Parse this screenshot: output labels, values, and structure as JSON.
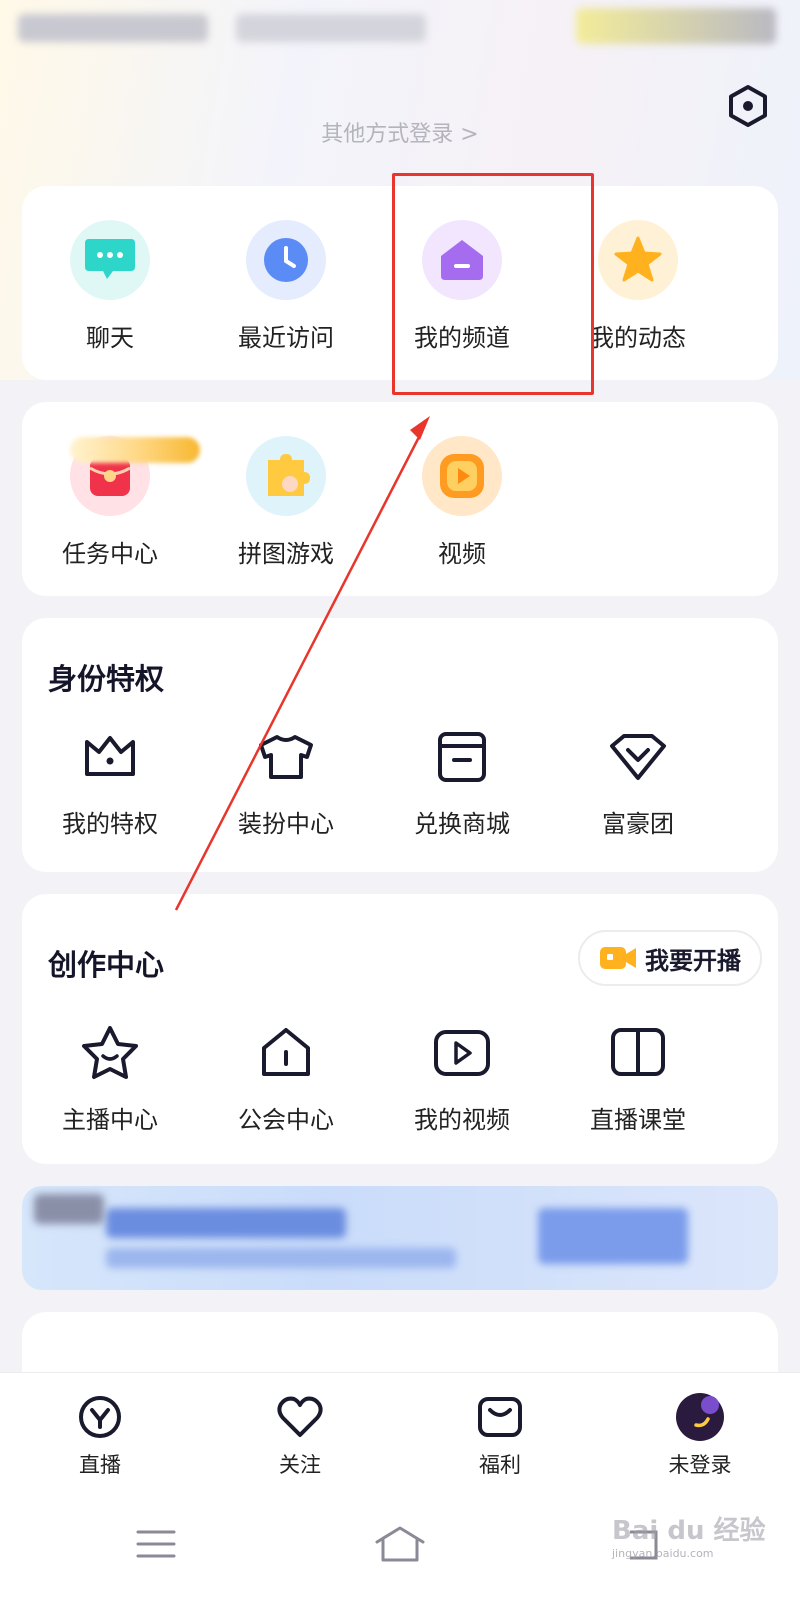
{
  "header": {
    "other_login": "其他方式登录 >"
  },
  "quick_actions": [
    {
      "label": "聊天",
      "icon": "chat-bubble-icon",
      "color": "#2ed6c9"
    },
    {
      "label": "最近访问",
      "icon": "clock-icon",
      "color": "#5b8cf5"
    },
    {
      "label": "我的频道",
      "icon": "channel-house-icon",
      "color": "#a66cf0"
    },
    {
      "label": "我的动态",
      "icon": "star-icon",
      "color": "#ffb21e"
    }
  ],
  "services": [
    {
      "label": "任务中心",
      "icon": "red-envelope-icon",
      "color": "#f0324a"
    },
    {
      "label": "拼图游戏",
      "icon": "puzzle-icon",
      "color": "#ffc940"
    },
    {
      "label": "视频",
      "icon": "video-play-icon",
      "color": "#ff9b20"
    }
  ],
  "privileges": {
    "title": "身份特权",
    "items": [
      {
        "label": "我的特权",
        "icon": "crown-icon"
      },
      {
        "label": "装扮中心",
        "icon": "tshirt-icon"
      },
      {
        "label": "兑换商城",
        "icon": "store-icon"
      },
      {
        "label": "富豪团",
        "icon": "diamond-icon"
      }
    ]
  },
  "creation": {
    "title": "创作中心",
    "live_button": "我要开播",
    "items": [
      {
        "label": "主播中心",
        "icon": "star-face-icon"
      },
      {
        "label": "公会中心",
        "icon": "guild-house-icon"
      },
      {
        "label": "我的视频",
        "icon": "play-square-icon"
      },
      {
        "label": "直播课堂",
        "icon": "book-icon"
      }
    ]
  },
  "tabbar": [
    {
      "label": "直播",
      "icon": "live-y-icon"
    },
    {
      "label": "关注",
      "icon": "heart-icon"
    },
    {
      "label": "福利",
      "icon": "gift-box-icon"
    },
    {
      "label": "未登录",
      "icon": "avatar-moon-icon"
    }
  ],
  "watermark": {
    "brand": "Bai du 经验",
    "url": "jingyan.baidu.com"
  },
  "colors": {
    "accent_red": "#e8362c",
    "card_bg": "#ffffff",
    "page_bg": "#f2f2f7"
  }
}
